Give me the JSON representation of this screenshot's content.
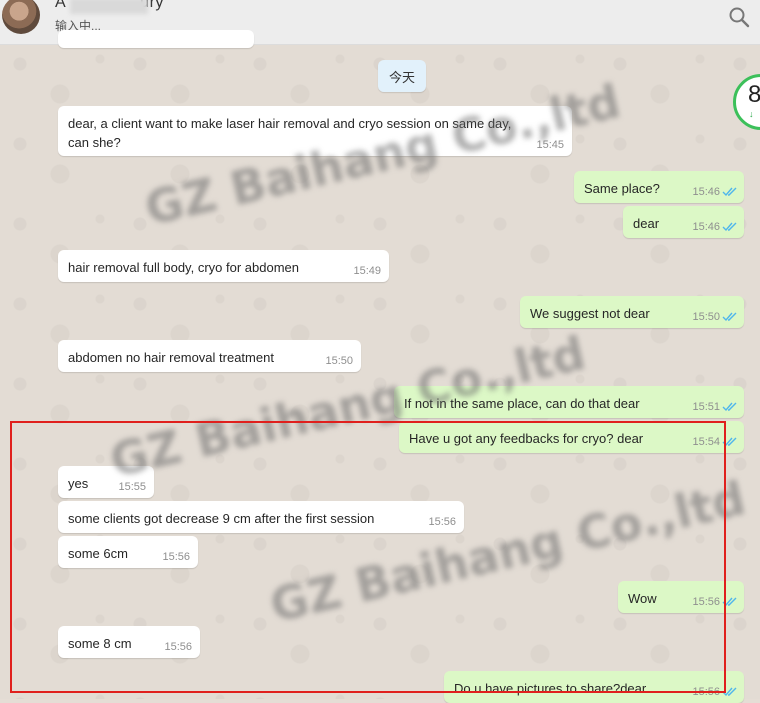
{
  "header": {
    "contact_name": "A",
    "contact_name_tail": "ury",
    "status": "输入中..."
  },
  "date_separator": "今天",
  "timer": {
    "value": "8",
    "sub": "↓"
  },
  "messages": [
    {
      "dir": "in",
      "text": "dear, a client want to make laser hair removal and cryo session on same day,\ncan she?",
      "time": "15:45"
    },
    {
      "dir": "out",
      "text": "Same place?",
      "time": "15:46"
    },
    {
      "dir": "out",
      "text": "dear",
      "time": "15:46"
    },
    {
      "dir": "in",
      "text": "hair removal full body, cryo for abdomen",
      "time": "15:49"
    },
    {
      "dir": "out",
      "text": "We suggest not dear",
      "time": "15:50"
    },
    {
      "dir": "in",
      "text": "abdomen no hair removal treatment",
      "time": "15:50"
    },
    {
      "dir": "out",
      "text": "If not in the same place, can do that dear",
      "time": "15:51"
    },
    {
      "dir": "out",
      "text": "Have u got any feedbacks for cryo? dear",
      "time": "15:54"
    },
    {
      "dir": "in",
      "text": "yes",
      "time": "15:55"
    },
    {
      "dir": "in",
      "text": "some clients got decrease 9 cm after the first session",
      "time": "15:56"
    },
    {
      "dir": "in",
      "text": "some 6cm",
      "time": "15:56"
    },
    {
      "dir": "out",
      "text": "Wow",
      "time": "15:56"
    },
    {
      "dir": "in",
      "text": "some 8 cm",
      "time": "15:56"
    },
    {
      "dir": "out",
      "text": "Do u have pictures to share?dear",
      "time": "15:56"
    }
  ],
  "watermarks": [
    "GZ Baihang Co.,ltd",
    "GZ Baihang Co.,ltd",
    "GZ Baihang Co.,ltd"
  ],
  "colors": {
    "incoming_bubble": "#ffffff",
    "outgoing_bubble": "#dcf8c6",
    "read_ticks": "#4fb6ec",
    "highlight_box": "#e0201d"
  },
  "icons": {
    "search": "search-icon",
    "read_receipt": "double-check-icon"
  }
}
